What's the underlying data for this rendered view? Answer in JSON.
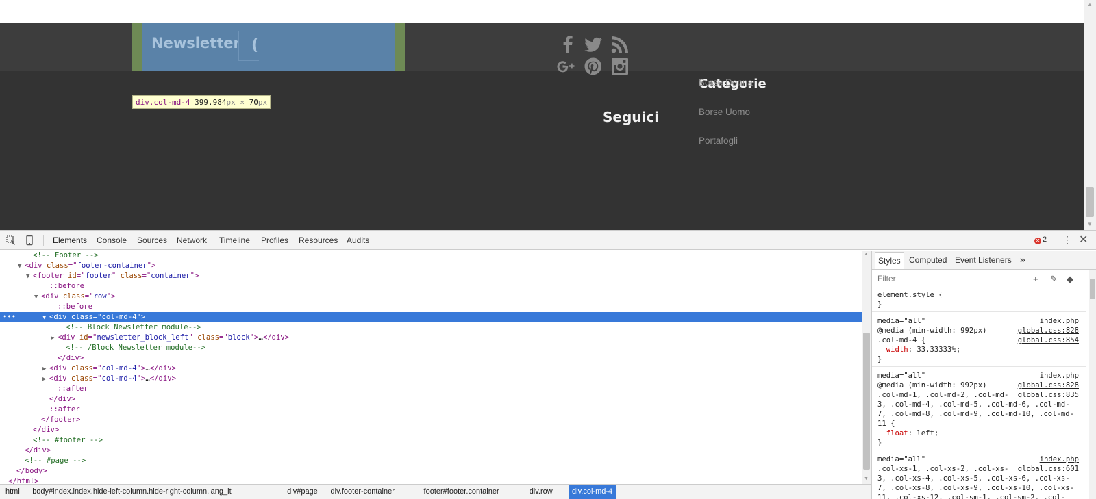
{
  "page": {
    "newsletter_title": "Newsletter",
    "tooltip": {
      "tag": "div.col-md-4",
      "width": "399.984",
      "height": "70",
      "unit": "px",
      "times": "×"
    },
    "seguici": "Seguici",
    "categorie_title": "Categorie",
    "categories": [
      "Borse Donna",
      "Borse Uomo",
      "Portafogli"
    ],
    "social_icons": [
      "facebook-icon",
      "twitter-icon",
      "rss-icon",
      "google-plus-icon",
      "pinterest-icon",
      "instagram-icon"
    ],
    "colors": {
      "footer_bg": "#333333",
      "highlight_margin": "#6e8a55",
      "highlight_content": "#5a82a8"
    }
  },
  "devtools": {
    "tabs": [
      "Elements",
      "Console",
      "Sources",
      "Network",
      "Timeline",
      "Profiles",
      "Resources",
      "Audits"
    ],
    "active_tab": "Elements",
    "error_count": "2",
    "dom_lines": [
      {
        "indent": 4,
        "tri": "",
        "html": "<span class=\"c\">&lt;!-- Footer --&gt;</span>"
      },
      {
        "indent": 3,
        "tri": "▼",
        "html": "<span class=\"t\">&lt;div </span><span class=\"a\">class</span><span class=\"t\">=\"</span><span class=\"v\">footer-container</span><span class=\"t\">\"&gt;</span>"
      },
      {
        "indent": 4,
        "tri": "▼",
        "html": "<span class=\"t\">&lt;footer </span><span class=\"a\">id</span><span class=\"t\">=\"</span><span class=\"v\">footer</span><span class=\"t\">\" </span><span class=\"a\">class</span><span class=\"t\">=\"</span><span class=\"v\">container</span><span class=\"t\">\"&gt;</span>"
      },
      {
        "indent": 6,
        "tri": "",
        "html": "<span class=\"p\">::before</span>"
      },
      {
        "indent": 5,
        "tri": "▼",
        "html": "<span class=\"t\">&lt;div </span><span class=\"a\">class</span><span class=\"t\">=\"</span><span class=\"v\">row</span><span class=\"t\">\"&gt;</span>"
      },
      {
        "indent": 7,
        "tri": "",
        "html": "<span class=\"p\">::before</span>"
      },
      {
        "indent": 6,
        "tri": "▼",
        "html": "<span class=\"t\">&lt;div </span><span class=\"a\">class</span><span class=\"t\">=\"</span><span class=\"v\">col-md-4</span><span class=\"t\">\"&gt;</span>",
        "selected": true
      },
      {
        "indent": 8,
        "tri": "",
        "html": "<span class=\"c\">&lt;!-- Block Newsletter module--&gt;</span>"
      },
      {
        "indent": 7,
        "tri": "▶",
        "html": "<span class=\"t\">&lt;div </span><span class=\"a\">id</span><span class=\"t\">=\"</span><span class=\"v\">newsletter_block_left</span><span class=\"t\">\" </span><span class=\"a\">class</span><span class=\"t\">=\"</span><span class=\"v\">block</span><span class=\"t\">\"&gt;</span>…<span class=\"t\">&lt;/div&gt;</span>"
      },
      {
        "indent": 8,
        "tri": "",
        "html": "<span class=\"c\">&lt;!-- /Block Newsletter module--&gt;</span>"
      },
      {
        "indent": 7,
        "tri": "",
        "html": "<span class=\"t\">&lt;/div&gt;</span>"
      },
      {
        "indent": 6,
        "tri": "▶",
        "html": "<span class=\"t\">&lt;div </span><span class=\"a\">class</span><span class=\"t\">=\"</span><span class=\"v\">col-md-4</span><span class=\"t\">\"&gt;</span>…<span class=\"t\">&lt;/div&gt;</span>"
      },
      {
        "indent": 6,
        "tri": "▶",
        "html": "<span class=\"t\">&lt;div </span><span class=\"a\">class</span><span class=\"t\">=\"</span><span class=\"v\">col-md-4</span><span class=\"t\">\"&gt;</span>…<span class=\"t\">&lt;/div&gt;</span>"
      },
      {
        "indent": 7,
        "tri": "",
        "html": "<span class=\"p\">::after</span>"
      },
      {
        "indent": 6,
        "tri": "",
        "html": "<span class=\"t\">&lt;/div&gt;</span>"
      },
      {
        "indent": 6,
        "tri": "",
        "html": "<span class=\"p\">::after</span>"
      },
      {
        "indent": 5,
        "tri": "",
        "html": "<span class=\"t\">&lt;/footer&gt;</span>"
      },
      {
        "indent": 4,
        "tri": "",
        "html": "<span class=\"t\">&lt;/div&gt;</span>"
      },
      {
        "indent": 4,
        "tri": "",
        "html": "<span class=\"c\">&lt;!-- #footer --&gt;</span>"
      },
      {
        "indent": 3,
        "tri": "",
        "html": "<span class=\"t\">&lt;/div&gt;</span>"
      },
      {
        "indent": 3,
        "tri": "",
        "html": "<span class=\"c\">&lt;!-- #page --&gt;</span>"
      },
      {
        "indent": 2,
        "tri": "",
        "html": "<span class=\"t\">&lt;/body&gt;</span>"
      },
      {
        "indent": 1,
        "tri": "",
        "html": "<span class=\"t\">&lt;/html&gt;</span>"
      }
    ],
    "breadcrumbs": [
      "html",
      "body#index.index.hide-left-column.hide-right-column.lang_it",
      "div#page",
      "div.footer-container",
      "footer#footer.container",
      "div.row",
      "div.col-md-4"
    ],
    "styles_tabs": [
      "Styles",
      "Computed",
      "Event Listeners",
      "»"
    ],
    "filter_placeholder": "Filter",
    "rules": [
      {
        "lines": [
          "element.style {",
          "}"
        ]
      },
      {
        "media": "media=\"all\"",
        "media_src": "index.php",
        "lines": [
          "@media (min-width: 992px)",
          ".col-md-4 {",
          "  width: 33.33333%;",
          "}"
        ],
        "srcs": [
          "global.css:828",
          "global.css:854"
        ]
      },
      {
        "media": "media=\"all\"",
        "media_src": "index.php",
        "lines": [
          "@media (min-width: 992px)",
          ".col-md-1, .col-md-2, .col-md-",
          "3, .col-md-4, .col-md-5, .col-md-6, .col-md-",
          "7, .col-md-8, .col-md-9, .col-md-10, .col-md-",
          "11 {",
          "  float: left;",
          "}"
        ],
        "srcs": [
          "global.css:828",
          "global.css:835"
        ]
      },
      {
        "media": "media=\"all\"",
        "media_src": "index.php",
        "lines": [
          ".col-xs-1, .col-xs-2, .col-xs-",
          "3, .col-xs-4, .col-xs-5, .col-xs-6, .col-xs-",
          "7, .col-xs-8, .col-xs-9, .col-xs-10, .col-xs-",
          "11, .col-xs-12, .col-sm-1, .col-sm-2, .col-"
        ],
        "srcs": [
          "global.css:601"
        ]
      }
    ]
  }
}
